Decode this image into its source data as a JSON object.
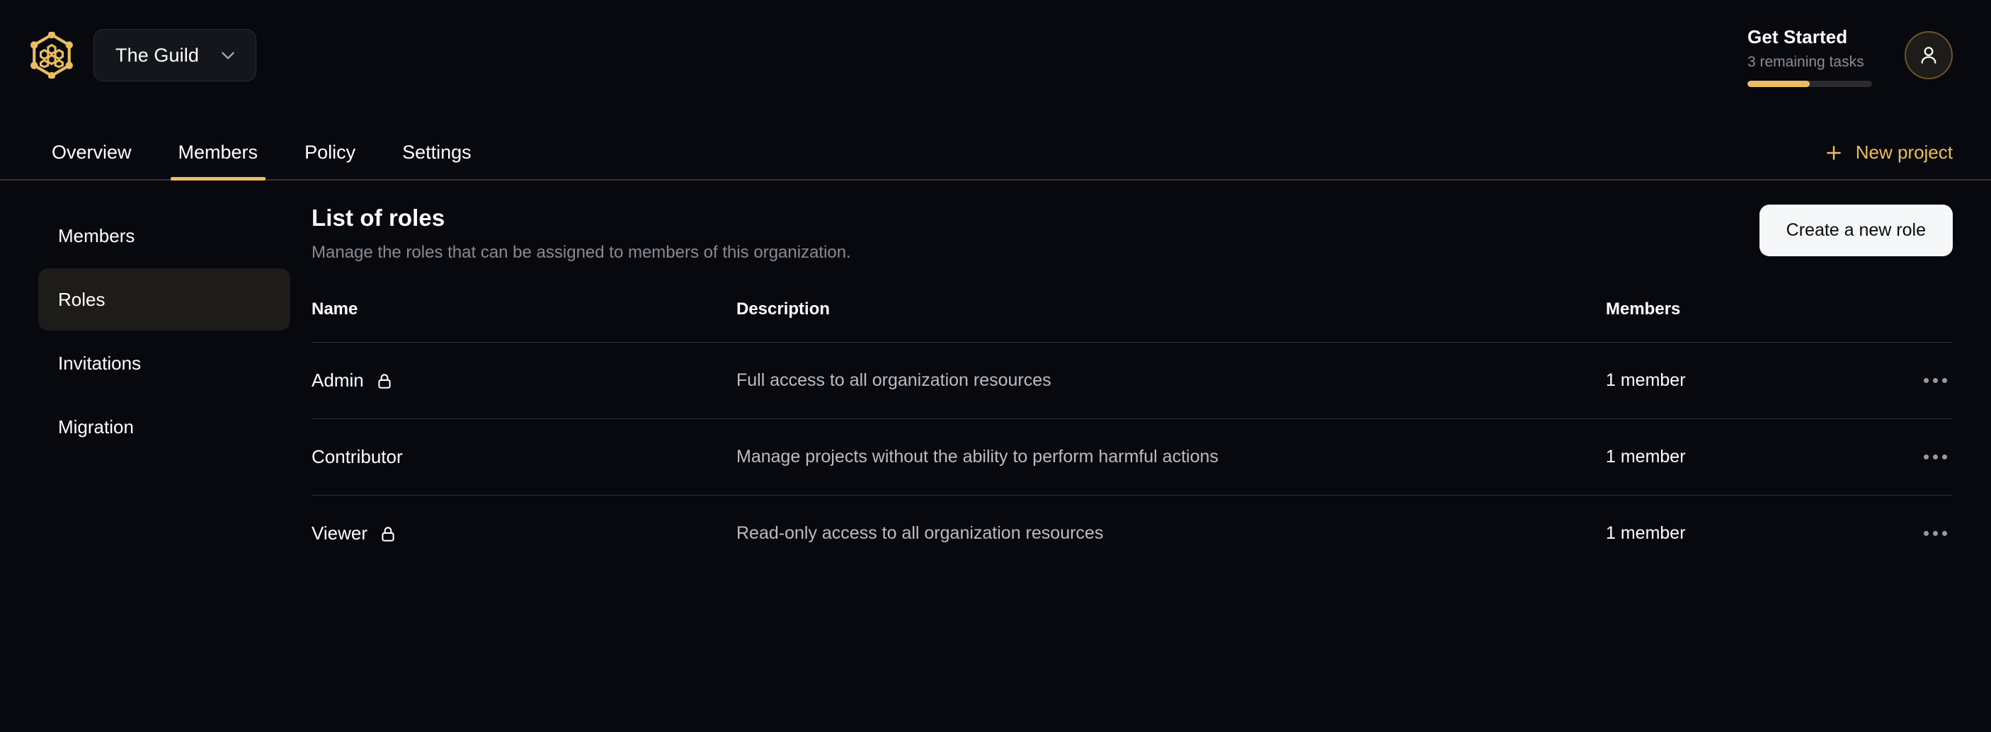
{
  "colors": {
    "background": "#07090f",
    "accent": "#ebbd61",
    "surface": "#1d1c1a",
    "divider": "#2e3038",
    "muted_text": "#8a8a90"
  },
  "topbar": {
    "logo_icon": "hexagon-honeycomb-logo",
    "org_switcher": {
      "label": "The Guild",
      "chevron_icon": "chevron-down-icon"
    },
    "get_started": {
      "title": "Get Started",
      "subtitle": "3 remaining tasks",
      "progress_percent": 50
    },
    "avatar_icon": "user-avatar-icon"
  },
  "nav": {
    "tabs": [
      {
        "label": "Overview",
        "active": false
      },
      {
        "label": "Members",
        "active": true
      },
      {
        "label": "Policy",
        "active": false
      },
      {
        "label": "Settings",
        "active": false
      }
    ],
    "new_project": {
      "label": "New project",
      "icon": "plus-icon"
    }
  },
  "sidebar": {
    "items": [
      {
        "label": "Members",
        "active": false
      },
      {
        "label": "Roles",
        "active": true
      },
      {
        "label": "Invitations",
        "active": false
      },
      {
        "label": "Migration",
        "active": false
      }
    ]
  },
  "main": {
    "title": "List of roles",
    "subtitle": "Manage the roles that can be assigned to members of this organization.",
    "create_button": "Create a new role",
    "table": {
      "columns": [
        "Name",
        "Description",
        "Members"
      ],
      "rows": [
        {
          "name": "Admin",
          "locked": true,
          "lock_icon": "lock-icon",
          "description": "Full access to all organization resources",
          "members": "1 member",
          "actions_icon": "more-horizontal-icon"
        },
        {
          "name": "Contributor",
          "locked": false,
          "lock_icon": "",
          "description": "Manage projects without the ability to perform harmful actions",
          "members": "1 member",
          "actions_icon": "more-horizontal-icon"
        },
        {
          "name": "Viewer",
          "locked": true,
          "lock_icon": "lock-icon",
          "description": "Read-only access to all organization resources",
          "members": "1 member",
          "actions_icon": "more-horizontal-icon"
        }
      ]
    }
  }
}
